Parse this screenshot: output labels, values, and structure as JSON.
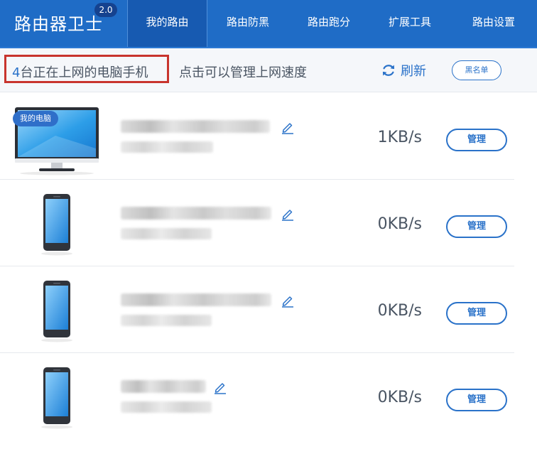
{
  "app": {
    "title": "路由器卫士",
    "version": "2.0"
  },
  "nav": {
    "tabs": [
      {
        "label": "我的路由",
        "active": true
      },
      {
        "label": "路由防黑",
        "active": false
      },
      {
        "label": "路由跑分",
        "active": false
      },
      {
        "label": "扩展工具",
        "active": false
      },
      {
        "label": "路由设置",
        "active": false
      }
    ]
  },
  "status": {
    "count": "4",
    "count_suffix": "台正在上网的电脑手机",
    "hint": "点击可以管理上网速度",
    "refresh_label": "刷新",
    "blacklist_label": "黑名单"
  },
  "devices": [
    {
      "type": "pc",
      "badge": "我的电脑",
      "speed": "1KB/s",
      "manage_label": "管理"
    },
    {
      "type": "phone",
      "speed": "0KB/s",
      "manage_label": "管理"
    },
    {
      "type": "phone",
      "speed": "0KB/s",
      "manage_label": "管理"
    },
    {
      "type": "phone",
      "speed": "0KB/s",
      "manage_label": "管理"
    }
  ],
  "colors": {
    "header": "#1f6cc6",
    "accent": "#2a72c9",
    "highlight_box": "#c8342d"
  }
}
